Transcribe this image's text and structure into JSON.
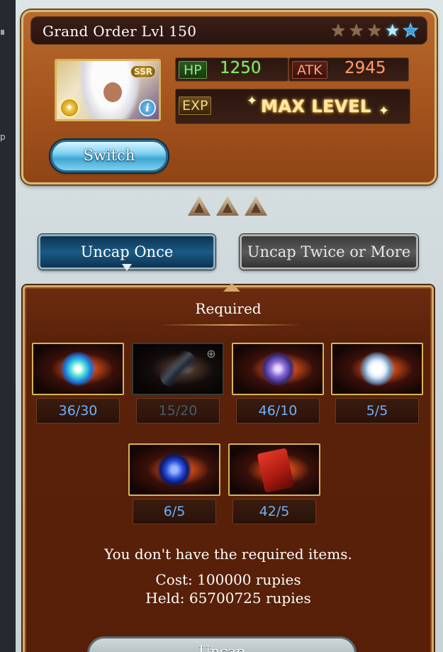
{
  "side": {
    "label": "p"
  },
  "card": {
    "title": "Grand Order Lvl 150",
    "rarity_badge": "SSR",
    "element_icon": "light-element-icon",
    "stars": [
      {
        "type": "bronze",
        "icon": "star-icon",
        "glyph": "★"
      },
      {
        "type": "bronze",
        "icon": "star-icon",
        "glyph": "★"
      },
      {
        "type": "bronze",
        "icon": "star-icon",
        "glyph": "★"
      },
      {
        "type": "blue-filled",
        "icon": "star-icon",
        "glyph": "★"
      },
      {
        "type": "blue-outline",
        "icon": "star-outline-icon",
        "glyph": "★"
      }
    ],
    "hp_label": "HP",
    "hp_value": "1250",
    "atk_label": "ATK",
    "atk_value": "2945",
    "exp_label": "EXP",
    "exp_value": "MAX LEVEL",
    "switch_label": "Switch"
  },
  "uncap_level": {
    "filled": 3,
    "total": 3
  },
  "tabs": {
    "once": "Uncap Once",
    "twice": "Uncap Twice or More"
  },
  "required": {
    "title": "Required",
    "items": [
      {
        "count": "36/30",
        "icon": "crystal-gem-icon",
        "available": true
      },
      {
        "count": "15/20",
        "icon": "blue-feather-icon",
        "available": false
      },
      {
        "count": "46/10",
        "icon": "dark-orb-icon",
        "available": true
      },
      {
        "count": "5/5",
        "icon": "white-flame-icon",
        "available": true
      },
      {
        "count": "6/5",
        "icon": "blue-flame-icon",
        "available": true
      },
      {
        "count": "42/5",
        "icon": "red-scroll-icon",
        "available": true
      }
    ],
    "message": "You don't have the required items.",
    "cost": "Cost: 100000 rupies",
    "held": "Held: 65700725 rupies",
    "bottom_button": "Uncap"
  },
  "colors": {
    "count_available": "#6fb0f8",
    "count_unavailable": "#4a5a6a",
    "hp": "#8eea6a",
    "atk": "#ff9a6a",
    "panel_brown": "#5a220a"
  }
}
